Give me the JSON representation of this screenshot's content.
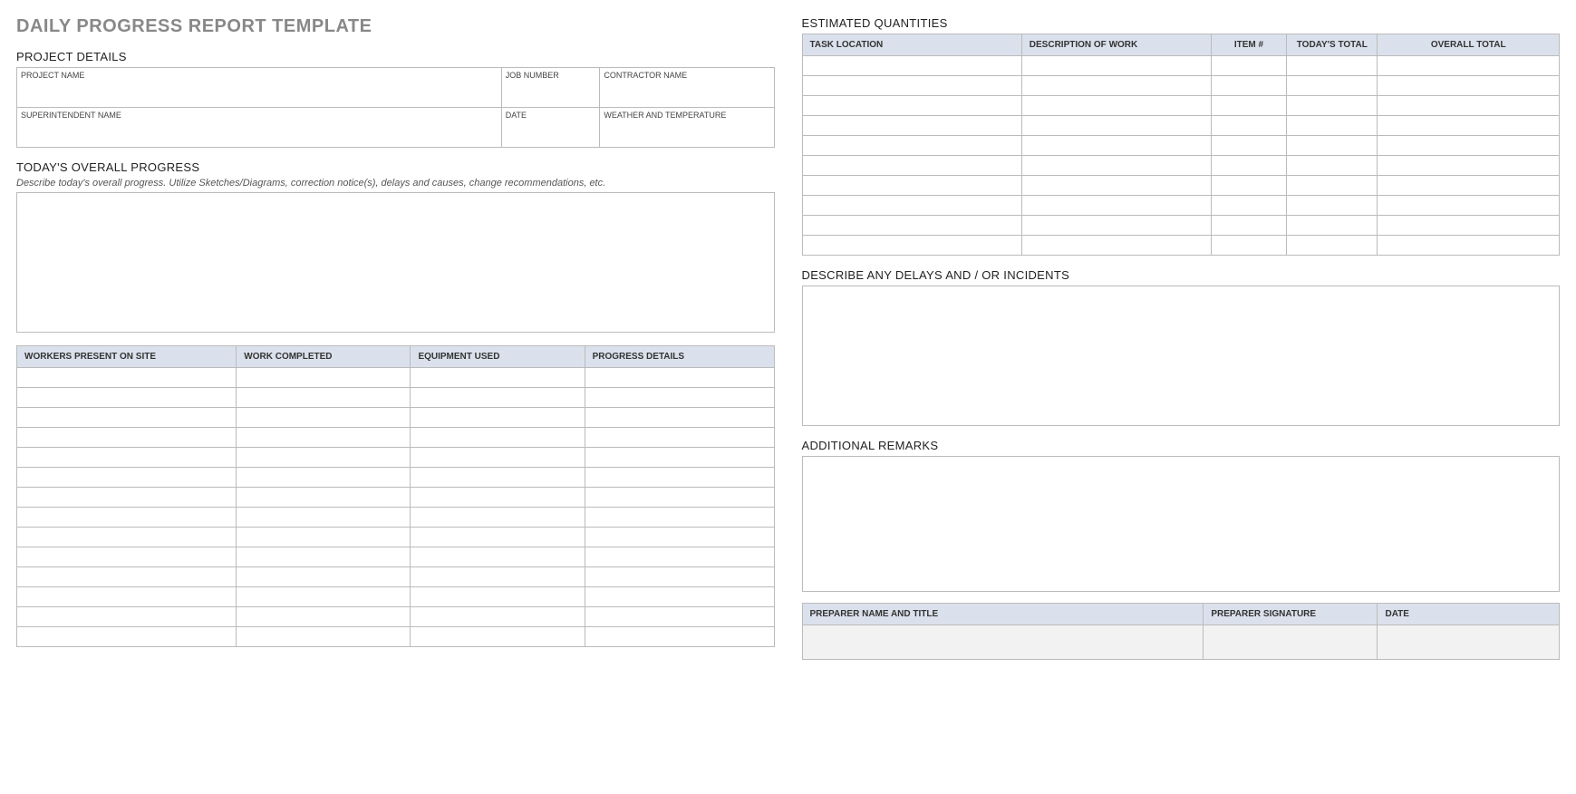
{
  "title": "DAILY PROGRESS REPORT TEMPLATE",
  "projectDetails": {
    "heading": "PROJECT DETAILS",
    "labels": {
      "projectName": "PROJECT NAME",
      "jobNumber": "JOB NUMBER",
      "contractorName": "CONTRACTOR NAME",
      "superintendentName": "SUPERINTENDENT NAME",
      "date": "DATE",
      "weather": "WEATHER AND TEMPERATURE"
    },
    "values": {
      "projectName": "",
      "jobNumber": "",
      "contractorName": "",
      "superintendentName": "",
      "date": "",
      "weather": ""
    }
  },
  "overallProgress": {
    "heading": "TODAY'S OVERALL PROGRESS",
    "hint": "Describe today's overall progress.  Utilize Sketches/Diagrams, correction notice(s), delays and causes, change recommendations, etc.",
    "value": ""
  },
  "progressTable": {
    "headers": [
      "WORKERS PRESENT ON SITE",
      "WORK COMPLETED",
      "EQUIPMENT USED",
      "PROGRESS DETAILS"
    ],
    "rows": [
      [
        "",
        "",
        "",
        ""
      ],
      [
        "",
        "",
        "",
        ""
      ],
      [
        "",
        "",
        "",
        ""
      ],
      [
        "",
        "",
        "",
        ""
      ],
      [
        "",
        "",
        "",
        ""
      ],
      [
        "",
        "",
        "",
        ""
      ],
      [
        "",
        "",
        "",
        ""
      ],
      [
        "",
        "",
        "",
        ""
      ],
      [
        "",
        "",
        "",
        ""
      ],
      [
        "",
        "",
        "",
        ""
      ],
      [
        "",
        "",
        "",
        ""
      ],
      [
        "",
        "",
        "",
        ""
      ],
      [
        "",
        "",
        "",
        ""
      ],
      [
        "",
        "",
        "",
        ""
      ]
    ]
  },
  "estimatedQuantities": {
    "heading": "ESTIMATED QUANTITIES",
    "headers": [
      "TASK LOCATION",
      "DESCRIPTION OF WORK",
      "ITEM #",
      "TODAY'S TOTAL",
      "OVERALL TOTAL"
    ],
    "rows": [
      [
        "",
        "",
        "",
        "",
        ""
      ],
      [
        "",
        "",
        "",
        "",
        ""
      ],
      [
        "",
        "",
        "",
        "",
        ""
      ],
      [
        "",
        "",
        "",
        "",
        ""
      ],
      [
        "",
        "",
        "",
        "",
        ""
      ],
      [
        "",
        "",
        "",
        "",
        ""
      ],
      [
        "",
        "",
        "",
        "",
        ""
      ],
      [
        "",
        "",
        "",
        "",
        ""
      ],
      [
        "",
        "",
        "",
        "",
        ""
      ],
      [
        "",
        "",
        "",
        "",
        ""
      ]
    ]
  },
  "delays": {
    "heading": "DESCRIBE ANY DELAYS AND / OR INCIDENTS",
    "value": ""
  },
  "remarks": {
    "heading": "ADDITIONAL REMARKS",
    "value": ""
  },
  "signoff": {
    "headers": [
      "PREPARER NAME AND TITLE",
      "PREPARER SIGNATURE",
      "DATE"
    ],
    "values": [
      "",
      "",
      ""
    ]
  }
}
